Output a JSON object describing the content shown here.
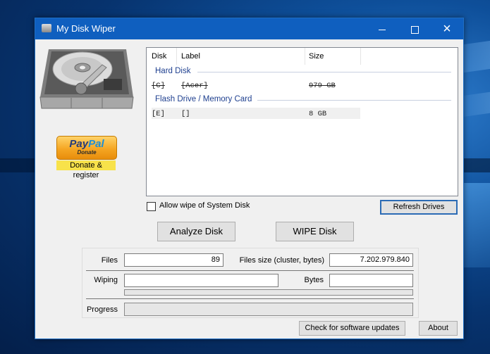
{
  "window": {
    "title": "My Disk Wiper",
    "icon": "hard-disk-icon",
    "controls": {
      "minimize": "minimize-icon",
      "maximize": "maximize-icon",
      "close": "×"
    }
  },
  "sidebar": {
    "image": "hard-disk-illustration",
    "paypal": {
      "brand_pay": "Pay",
      "brand_pal": "Pal",
      "sub": "Donate"
    },
    "donate_register": "Donate & register"
  },
  "drive_list": {
    "columns": [
      "Disk",
      "Label",
      "Size"
    ],
    "groups": [
      {
        "name": "Hard Disk",
        "rows": [
          {
            "disk": "[C]",
            "label": "[Acer]",
            "size": "979 GB",
            "disabled": true
          }
        ]
      },
      {
        "name": "Flash Drive / Memory Card",
        "rows": [
          {
            "disk": "[E]",
            "label": "[]",
            "size": "8 GB",
            "selected": true
          }
        ]
      }
    ]
  },
  "options": {
    "allow_system_wipe_label": "Allow wipe of System Disk",
    "allow_system_wipe_checked": false
  },
  "buttons": {
    "refresh": "Refresh Drives",
    "analyze": "Analyze Disk",
    "wipe": "WIPE Disk",
    "check_updates": "Check for software updates",
    "about": "About"
  },
  "stats": {
    "files_label": "Files",
    "files_value": "89",
    "files_size_label": "Files size (cluster, bytes)",
    "files_size_value": "7.202.979.840",
    "wiping_label": "Wiping",
    "wiping_value": "",
    "bytes_label": "Bytes",
    "bytes_value": "",
    "wiping_progress": 0,
    "progress_label": "Progress",
    "progress_value": 0
  }
}
